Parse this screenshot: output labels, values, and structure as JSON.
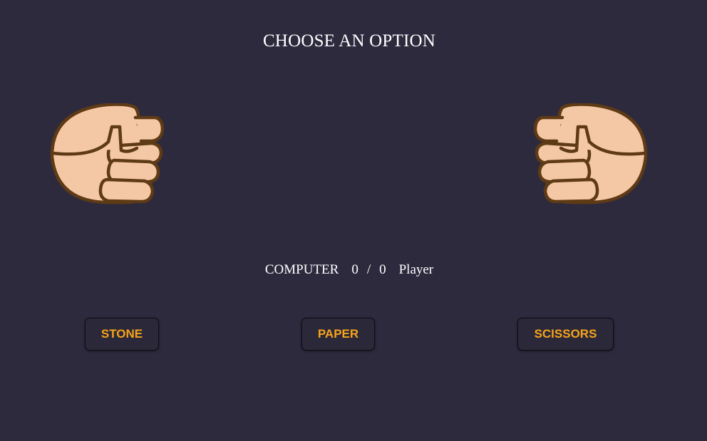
{
  "game": {
    "title": "CHOOSE AN OPTION"
  },
  "hands": {
    "computer_icon": "fist-icon",
    "player_icon": "fist-icon",
    "colors": {
      "skin": "#f5c8a5",
      "outline": "#5e3a15"
    }
  },
  "scoreboard": {
    "computer_label": "COMPUTER",
    "computer_score": "0",
    "separator": "/",
    "player_score": "0",
    "player_label": "Player"
  },
  "buttons": {
    "stone": "STONE",
    "paper": "PAPER",
    "scissors": "SCISSORS"
  },
  "theme": {
    "background": "#2d2a3e",
    "accent": "#f5a31a"
  }
}
